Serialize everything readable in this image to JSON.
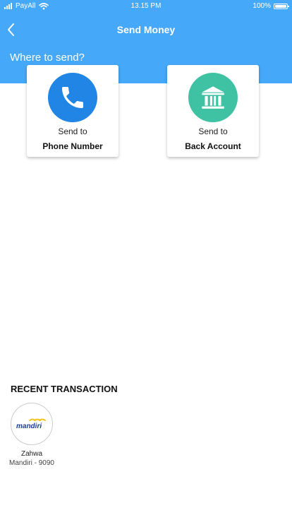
{
  "status_bar": {
    "carrier": "PayAll",
    "time": "13.15 PM",
    "battery": "100%"
  },
  "nav": {
    "title": "Send Money",
    "back_icon": "chevron-left-icon"
  },
  "section_title": "Where to send?",
  "options": [
    {
      "line1": "Send to",
      "line2": "Phone Number",
      "icon": "phone-icon",
      "color": "#2185e6"
    },
    {
      "line1": "Send to",
      "line2": "Back Account",
      "icon": "bank-icon",
      "color": "#3fc2a4"
    }
  ],
  "recent": {
    "title": "RECENT TRANSACTION",
    "items": [
      {
        "logo": "mandiri",
        "name": "Zahwa",
        "detail": "Mandiri - 9090"
      }
    ]
  },
  "colors": {
    "primary": "#45a8f8",
    "phone": "#2185e6",
    "bank": "#3fc2a4",
    "mandiri_navy": "#1d3f8f",
    "mandiri_yellow": "#f7c21a"
  }
}
